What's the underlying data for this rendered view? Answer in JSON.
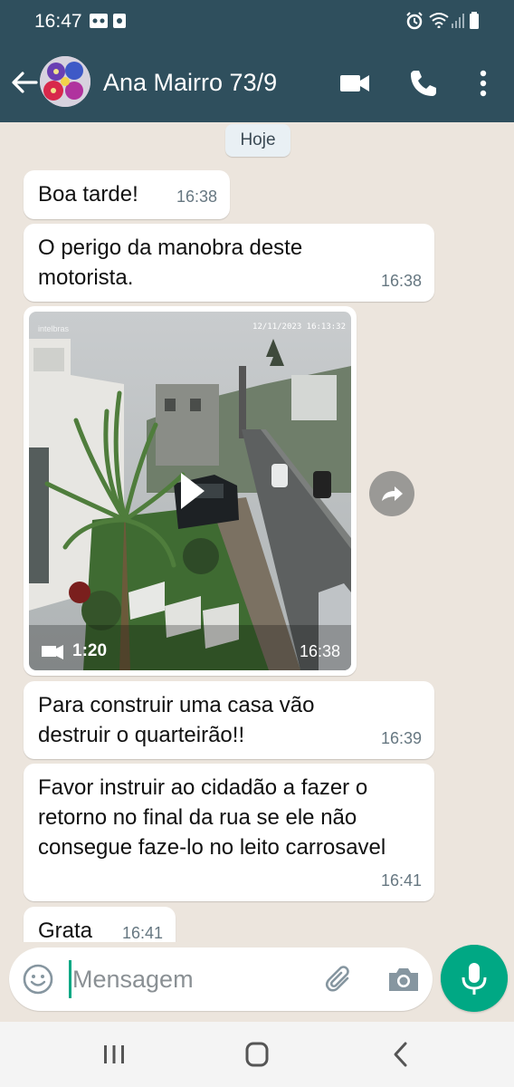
{
  "status_bar": {
    "time": "16:47"
  },
  "header": {
    "contact_name": "Ana Mairro 73/9"
  },
  "chat": {
    "date_chip": "Hoje",
    "messages": [
      {
        "text": "Boa tarde!",
        "time": "16:38"
      },
      {
        "text": "O perigo da manobra deste motorista.",
        "time": "16:38"
      },
      {
        "video_duration": "1:20",
        "time": "16:38",
        "overlay_stamp": "12/11/2023 16:13:32",
        "brand_overlay": "intelbras"
      },
      {
        "text": "Para construir uma casa vão destruir o quarteirão!!",
        "time": "16:39"
      },
      {
        "text": "Favor instruir ao cidadão a fazer o retorno no final da rua se ele não consegue faze-lo no leito carrosavel",
        "time": "16:41"
      },
      {
        "text": "Grata",
        "time": "16:41"
      }
    ]
  },
  "input": {
    "placeholder": "Mensagem"
  },
  "colors": {
    "header": "#2f4f5d",
    "accent": "#00a884",
    "chat_bg": "#ece5dd",
    "bubble": "#ffffff"
  },
  "icons": [
    "back-arrow-icon",
    "video-call-icon",
    "phone-icon",
    "more-vert-icon",
    "forward-icon",
    "play-icon",
    "emoji-icon",
    "attach-icon",
    "camera-icon",
    "mic-icon",
    "recents-icon",
    "home-icon",
    "back-nav-icon"
  ]
}
